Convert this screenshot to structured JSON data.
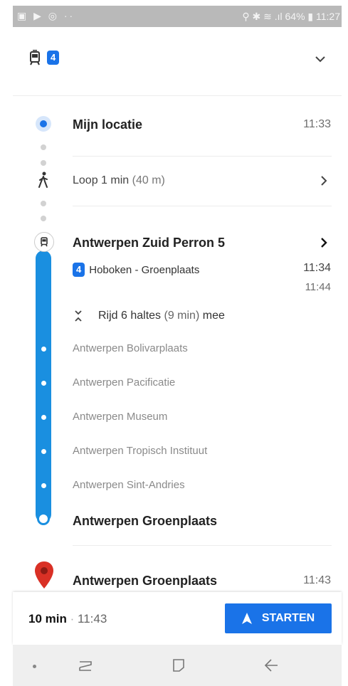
{
  "status_bar": {
    "left_icons": "▣ ▶ ◎ ··",
    "right_text": "⚲ ✱ ≋ .ıl 64% ▮ 11:27"
  },
  "header": {
    "route_number": "4"
  },
  "origin": {
    "label": "Mijn locatie",
    "time": "11:33"
  },
  "walk": {
    "text": "Loop 1 min",
    "detail": "(40 m)"
  },
  "transit": {
    "station": "Antwerpen Zuid Perron 5",
    "route_number": "4",
    "route_name": "Hoboken - Groenplaats",
    "time_1": "11:34",
    "time_2": "11:44",
    "ride_prefix": "Rijd 6 haltes",
    "ride_detail": "(9 min)",
    "ride_suffix": "mee",
    "stops": [
      "Antwerpen Bolivarplaats",
      "Antwerpen Pacificatie",
      "Antwerpen Museum",
      "Antwerpen Tropisch Instituut",
      "Antwerpen Sint-Andries"
    ],
    "end_stop": "Antwerpen Groenplaats"
  },
  "destination": {
    "label": "Antwerpen Groenplaats",
    "time": "11:43"
  },
  "bottom": {
    "duration": "10 min",
    "separator": "·",
    "arrival": "11:43",
    "start_label": "STARTEN"
  },
  "colors": {
    "accent": "#1a73e8",
    "line": "#1a8fe0",
    "pin": "#d93025"
  },
  "icons": [
    "tram-icon",
    "expand-chevron-icon",
    "location-dot-icon",
    "walk-icon",
    "chevron-right-icon",
    "collapse-expand-icon",
    "map-pin-icon",
    "navigation-arrow-icon",
    "recent-apps-icon",
    "home-icon",
    "back-icon"
  ]
}
